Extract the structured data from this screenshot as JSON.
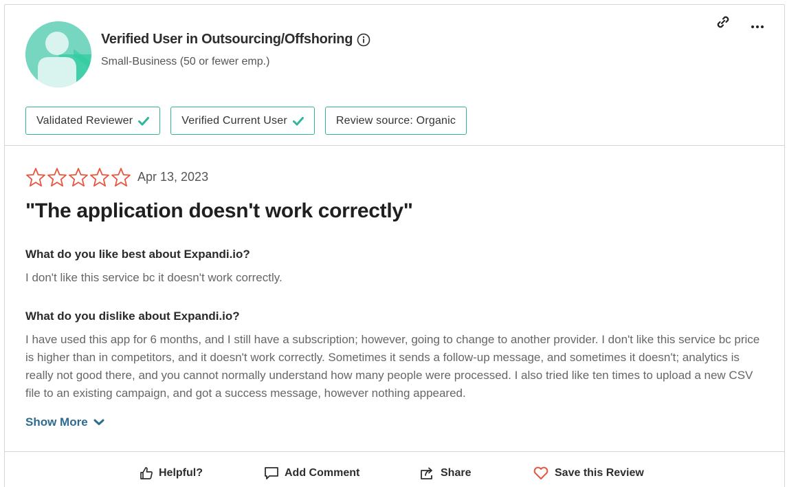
{
  "reviewer": {
    "name": "Verified User in Outsourcing/Offshoring",
    "segment": "Small-Business (50 or fewer emp.)"
  },
  "badges": [
    {
      "label": "Validated Reviewer",
      "checked": true
    },
    {
      "label": "Verified Current User",
      "checked": true
    },
    {
      "label": "Review source: Organic",
      "checked": false
    }
  ],
  "review": {
    "rating": 0,
    "date": "Apr 13, 2023",
    "title": "\"The application doesn't work correctly\"",
    "questions": [
      {
        "question": "What do you like best about Expandi.io?",
        "answer": "I don't like this service bc it doesn't work correctly."
      },
      {
        "question": "What do you dislike about Expandi.io?",
        "answer": "I have used this app for 6 months, and I still have a subscription; however, going to change to another provider. I don't like this service bc price is higher than in competitors, and it doesn't work correctly. Sometimes it sends a follow-up message, and sometimes it doesn't; analytics is really not good there, and you cannot normally understand how many people were processed. I also tried like ten times to upload a new CSV file to an existing campaign, and got a success message, however nothing appeared."
      }
    ],
    "show_more_label": "Show More"
  },
  "actions": {
    "helpful": "Helpful?",
    "add_comment": "Add Comment",
    "share": "Share",
    "save": "Save this Review"
  },
  "colors": {
    "accent_teal": "#2fb69a",
    "star_outline": "#e8553e",
    "link_blue": "#2e6b8f",
    "heart": "#e8553e"
  },
  "icons": [
    "info-icon",
    "link-icon",
    "more-icon",
    "check-icon",
    "star-icon",
    "chevron-down-icon",
    "thumbs-up-icon",
    "comment-icon",
    "share-icon",
    "heart-icon"
  ]
}
